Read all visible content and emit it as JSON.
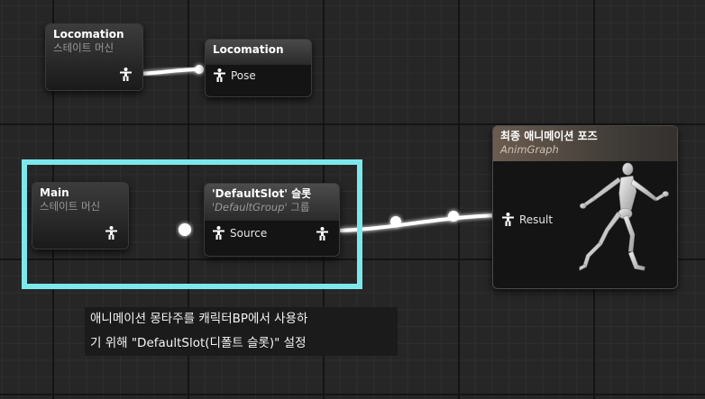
{
  "nodes": {
    "locomotion_sm": {
      "title": "Locomation",
      "subtitle": "스테이트 머신"
    },
    "locomotion_pose": {
      "title": "Locomation",
      "pin_label": "Pose"
    },
    "main_sm": {
      "title": "Main",
      "subtitle": "스테이트 머신"
    },
    "slot": {
      "title_quoted": "'DefaultSlot'",
      "title_suffix": " 슬롯",
      "subtitle_quoted": "'DefaultGroup'",
      "subtitle_suffix": " 그룹",
      "pin_label": "Source"
    },
    "result": {
      "title": "최종 애니메이션 포즈",
      "subtitle": "AnimGraph",
      "pin_label": "Result"
    }
  },
  "caption": {
    "line1": "애니메이션 몽타주를 캐릭터BP에서 사용하",
    "line2": "기 위해 \"DefaultSlot(디폴트 슬롯)\" 설정"
  },
  "colors": {
    "highlight": "#7de8ec",
    "wire": "#ffffff",
    "grid_background": "#262626",
    "result_header": "#6b5c50"
  },
  "icons": {
    "pose_pin": "person-pose-icon"
  }
}
